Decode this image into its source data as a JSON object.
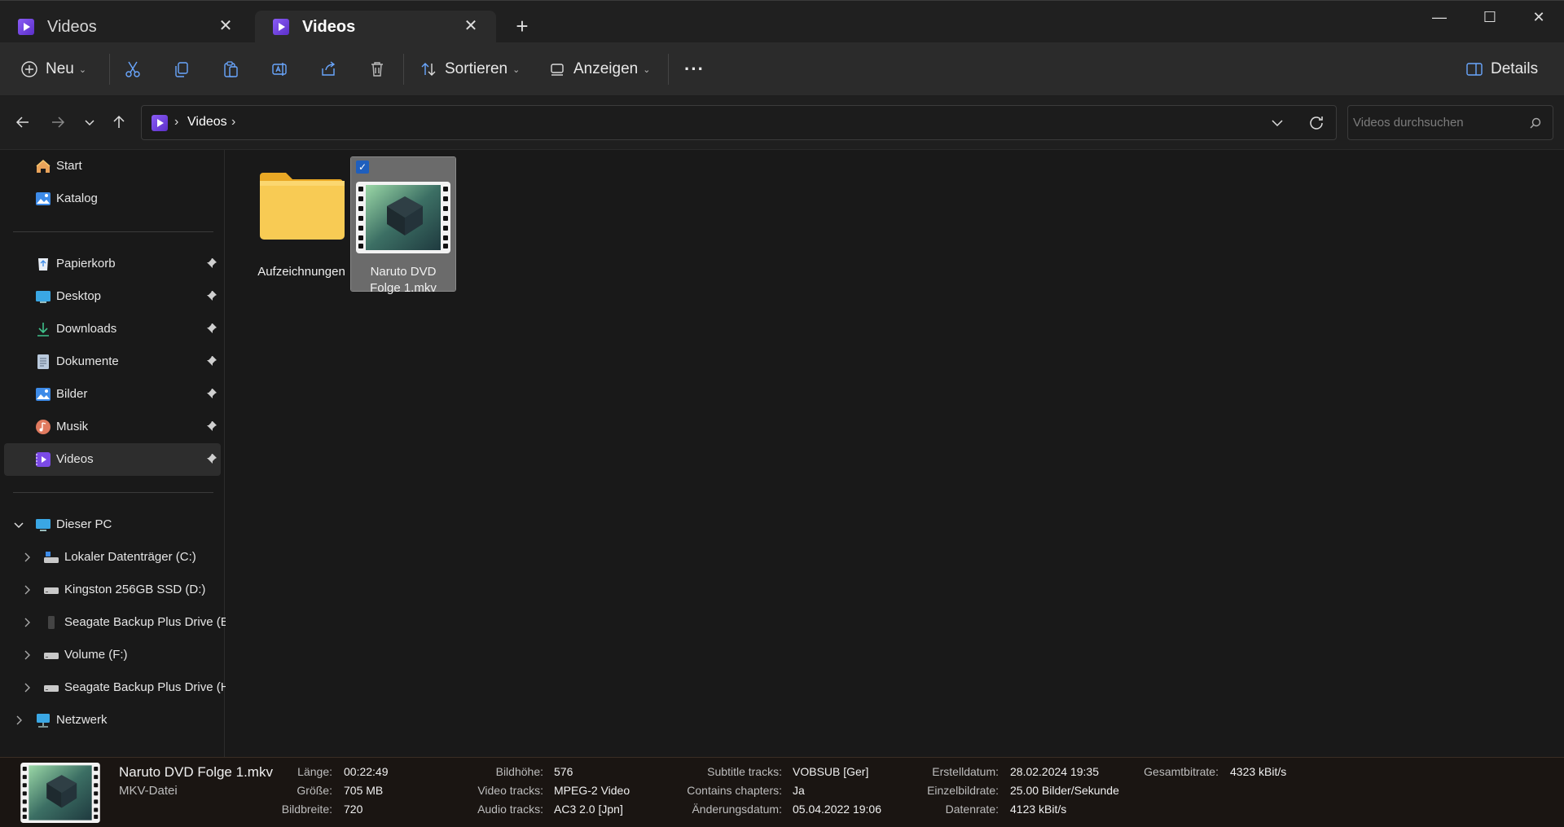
{
  "tabs": [
    {
      "label": "Videos",
      "active": false
    },
    {
      "label": "Videos",
      "active": true
    }
  ],
  "tab_add": "+",
  "window": {
    "minimize": "—",
    "maximize": "☐",
    "close": "✕"
  },
  "toolbar": {
    "new_label": "Neu",
    "sort_label": "Sortieren",
    "view_label": "Anzeigen",
    "more_label": "···",
    "details_label": "Details"
  },
  "address": {
    "crumbs": [
      "Videos"
    ],
    "separator": "›"
  },
  "search": {
    "placeholder": "Videos durchsuchen"
  },
  "sidebar": {
    "top": [
      {
        "label": "Start",
        "icon": "home-icon"
      },
      {
        "label": "Katalog",
        "icon": "gallery-icon"
      }
    ],
    "quick": [
      {
        "label": "Papierkorb",
        "icon": "recycle-bin-icon"
      },
      {
        "label": "Desktop",
        "icon": "desktop-icon"
      },
      {
        "label": "Downloads",
        "icon": "download-icon"
      },
      {
        "label": "Dokumente",
        "icon": "document-icon"
      },
      {
        "label": "Bilder",
        "icon": "pictures-icon"
      },
      {
        "label": "Musik",
        "icon": "music-icon"
      },
      {
        "label": "Videos",
        "icon": "videos-icon",
        "active": true
      }
    ],
    "pc": {
      "label": "Dieser PC"
    },
    "drives": [
      {
        "label": "Lokaler Datenträger (C:)"
      },
      {
        "label": "Kingston 256GB SSD (D:)"
      },
      {
        "label": "Seagate Backup Plus Drive (E"
      },
      {
        "label": "Volume (F:)"
      },
      {
        "label": "Seagate Backup Plus Drive (H"
      }
    ],
    "network": {
      "label": "Netzwerk"
    }
  },
  "files": [
    {
      "name": "Aufzeichnungen",
      "type": "folder"
    },
    {
      "name_line1": "Naruto DVD",
      "name_line2": "Folge 1.mkv",
      "type": "video",
      "selected": true
    }
  ],
  "details": {
    "name": "Naruto DVD Folge 1.mkv",
    "type": "MKV-Datei",
    "props": [
      {
        "k": "Länge:",
        "v": "00:22:49"
      },
      {
        "k": "Größe:",
        "v": "705 MB"
      },
      {
        "k": "Bildbreite:",
        "v": "720"
      },
      {
        "k": "Bildhöhe:",
        "v": "576"
      },
      {
        "k": "Video tracks:",
        "v": "MPEG-2 Video"
      },
      {
        "k": "Audio tracks:",
        "v": "AC3 2.0 [Jpn]"
      },
      {
        "k": "Subtitle tracks:",
        "v": "VOBSUB [Ger]"
      },
      {
        "k": "Contains chapters:",
        "v": "Ja"
      },
      {
        "k": "Änderungsdatum:",
        "v": "05.04.2022 19:06"
      },
      {
        "k": "Erstelldatum:",
        "v": "28.02.2024 19:35"
      },
      {
        "k": "Einzelbildrate:",
        "v": "25.00 Bilder/Sekunde"
      },
      {
        "k": "Datenrate:",
        "v": "4123 kBit/s"
      },
      {
        "k": "Gesamtbitrate:",
        "v": "4323 kBit/s"
      }
    ]
  },
  "colors": {
    "accent": "#1f5fbd",
    "folder": "#f5c33b",
    "videos_icon": "#7b4ae6"
  }
}
